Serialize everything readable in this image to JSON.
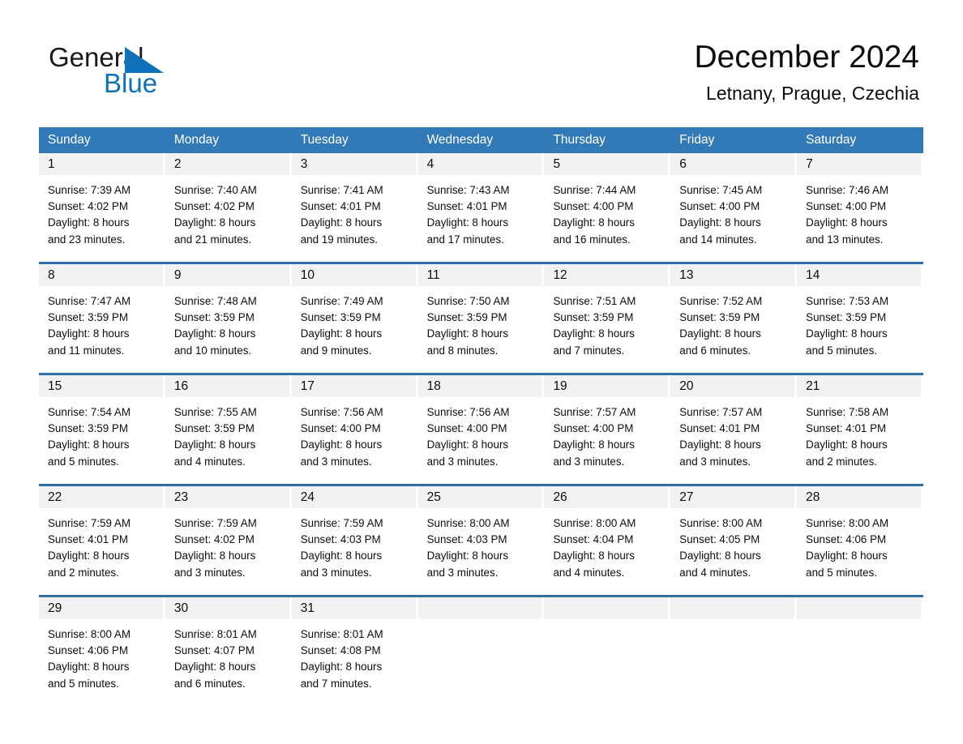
{
  "brand": {
    "name_part1": "General",
    "name_part2": "Blue",
    "triangle_color": "#0f71b9",
    "text_color": "#1a1a1a"
  },
  "header": {
    "title": "December 2024",
    "location": "Letnany, Prague, Czechia"
  },
  "theme": {
    "header_band": "#3279b7",
    "week_divider": "#2f6ea8",
    "day_band": "#f2f2f2",
    "text": "#0d0d0d",
    "page_background": "#ffffff"
  },
  "weekdays": [
    "Sunday",
    "Monday",
    "Tuesday",
    "Wednesday",
    "Thursday",
    "Friday",
    "Saturday"
  ],
  "labels": {
    "sunrise_prefix": "Sunrise:",
    "sunset_prefix": "Sunset:",
    "daylight_prefix": "Daylight:"
  },
  "weeks": [
    [
      {
        "day": "1",
        "sunrise": "Sunrise: 7:39 AM",
        "sunset": "Sunset: 4:02 PM",
        "daylight_line1": "Daylight: 8 hours",
        "daylight_line2": "and 23 minutes."
      },
      {
        "day": "2",
        "sunrise": "Sunrise: 7:40 AM",
        "sunset": "Sunset: 4:02 PM",
        "daylight_line1": "Daylight: 8 hours",
        "daylight_line2": "and 21 minutes."
      },
      {
        "day": "3",
        "sunrise": "Sunrise: 7:41 AM",
        "sunset": "Sunset: 4:01 PM",
        "daylight_line1": "Daylight: 8 hours",
        "daylight_line2": "and 19 minutes."
      },
      {
        "day": "4",
        "sunrise": "Sunrise: 7:43 AM",
        "sunset": "Sunset: 4:01 PM",
        "daylight_line1": "Daylight: 8 hours",
        "daylight_line2": "and 17 minutes."
      },
      {
        "day": "5",
        "sunrise": "Sunrise: 7:44 AM",
        "sunset": "Sunset: 4:00 PM",
        "daylight_line1": "Daylight: 8 hours",
        "daylight_line2": "and 16 minutes."
      },
      {
        "day": "6",
        "sunrise": "Sunrise: 7:45 AM",
        "sunset": "Sunset: 4:00 PM",
        "daylight_line1": "Daylight: 8 hours",
        "daylight_line2": "and 14 minutes."
      },
      {
        "day": "7",
        "sunrise": "Sunrise: 7:46 AM",
        "sunset": "Sunset: 4:00 PM",
        "daylight_line1": "Daylight: 8 hours",
        "daylight_line2": "and 13 minutes."
      }
    ],
    [
      {
        "day": "8",
        "sunrise": "Sunrise: 7:47 AM",
        "sunset": "Sunset: 3:59 PM",
        "daylight_line1": "Daylight: 8 hours",
        "daylight_line2": "and 11 minutes."
      },
      {
        "day": "9",
        "sunrise": "Sunrise: 7:48 AM",
        "sunset": "Sunset: 3:59 PM",
        "daylight_line1": "Daylight: 8 hours",
        "daylight_line2": "and 10 minutes."
      },
      {
        "day": "10",
        "sunrise": "Sunrise: 7:49 AM",
        "sunset": "Sunset: 3:59 PM",
        "daylight_line1": "Daylight: 8 hours",
        "daylight_line2": "and 9 minutes."
      },
      {
        "day": "11",
        "sunrise": "Sunrise: 7:50 AM",
        "sunset": "Sunset: 3:59 PM",
        "daylight_line1": "Daylight: 8 hours",
        "daylight_line2": "and 8 minutes."
      },
      {
        "day": "12",
        "sunrise": "Sunrise: 7:51 AM",
        "sunset": "Sunset: 3:59 PM",
        "daylight_line1": "Daylight: 8 hours",
        "daylight_line2": "and 7 minutes."
      },
      {
        "day": "13",
        "sunrise": "Sunrise: 7:52 AM",
        "sunset": "Sunset: 3:59 PM",
        "daylight_line1": "Daylight: 8 hours",
        "daylight_line2": "and 6 minutes."
      },
      {
        "day": "14",
        "sunrise": "Sunrise: 7:53 AM",
        "sunset": "Sunset: 3:59 PM",
        "daylight_line1": "Daylight: 8 hours",
        "daylight_line2": "and 5 minutes."
      }
    ],
    [
      {
        "day": "15",
        "sunrise": "Sunrise: 7:54 AM",
        "sunset": "Sunset: 3:59 PM",
        "daylight_line1": "Daylight: 8 hours",
        "daylight_line2": "and 5 minutes."
      },
      {
        "day": "16",
        "sunrise": "Sunrise: 7:55 AM",
        "sunset": "Sunset: 3:59 PM",
        "daylight_line1": "Daylight: 8 hours",
        "daylight_line2": "and 4 minutes."
      },
      {
        "day": "17",
        "sunrise": "Sunrise: 7:56 AM",
        "sunset": "Sunset: 4:00 PM",
        "daylight_line1": "Daylight: 8 hours",
        "daylight_line2": "and 3 minutes."
      },
      {
        "day": "18",
        "sunrise": "Sunrise: 7:56 AM",
        "sunset": "Sunset: 4:00 PM",
        "daylight_line1": "Daylight: 8 hours",
        "daylight_line2": "and 3 minutes."
      },
      {
        "day": "19",
        "sunrise": "Sunrise: 7:57 AM",
        "sunset": "Sunset: 4:00 PM",
        "daylight_line1": "Daylight: 8 hours",
        "daylight_line2": "and 3 minutes."
      },
      {
        "day": "20",
        "sunrise": "Sunrise: 7:57 AM",
        "sunset": "Sunset: 4:01 PM",
        "daylight_line1": "Daylight: 8 hours",
        "daylight_line2": "and 3 minutes."
      },
      {
        "day": "21",
        "sunrise": "Sunrise: 7:58 AM",
        "sunset": "Sunset: 4:01 PM",
        "daylight_line1": "Daylight: 8 hours",
        "daylight_line2": "and 2 minutes."
      }
    ],
    [
      {
        "day": "22",
        "sunrise": "Sunrise: 7:59 AM",
        "sunset": "Sunset: 4:01 PM",
        "daylight_line1": "Daylight: 8 hours",
        "daylight_line2": "and 2 minutes."
      },
      {
        "day": "23",
        "sunrise": "Sunrise: 7:59 AM",
        "sunset": "Sunset: 4:02 PM",
        "daylight_line1": "Daylight: 8 hours",
        "daylight_line2": "and 3 minutes."
      },
      {
        "day": "24",
        "sunrise": "Sunrise: 7:59 AM",
        "sunset": "Sunset: 4:03 PM",
        "daylight_line1": "Daylight: 8 hours",
        "daylight_line2": "and 3 minutes."
      },
      {
        "day": "25",
        "sunrise": "Sunrise: 8:00 AM",
        "sunset": "Sunset: 4:03 PM",
        "daylight_line1": "Daylight: 8 hours",
        "daylight_line2": "and 3 minutes."
      },
      {
        "day": "26",
        "sunrise": "Sunrise: 8:00 AM",
        "sunset": "Sunset: 4:04 PM",
        "daylight_line1": "Daylight: 8 hours",
        "daylight_line2": "and 4 minutes."
      },
      {
        "day": "27",
        "sunrise": "Sunrise: 8:00 AM",
        "sunset": "Sunset: 4:05 PM",
        "daylight_line1": "Daylight: 8 hours",
        "daylight_line2": "and 4 minutes."
      },
      {
        "day": "28",
        "sunrise": "Sunrise: 8:00 AM",
        "sunset": "Sunset: 4:06 PM",
        "daylight_line1": "Daylight: 8 hours",
        "daylight_line2": "and 5 minutes."
      }
    ],
    [
      {
        "day": "29",
        "sunrise": "Sunrise: 8:00 AM",
        "sunset": "Sunset: 4:06 PM",
        "daylight_line1": "Daylight: 8 hours",
        "daylight_line2": "and 5 minutes."
      },
      {
        "day": "30",
        "sunrise": "Sunrise: 8:01 AM",
        "sunset": "Sunset: 4:07 PM",
        "daylight_line1": "Daylight: 8 hours",
        "daylight_line2": "and 6 minutes."
      },
      {
        "day": "31",
        "sunrise": "Sunrise: 8:01 AM",
        "sunset": "Sunset: 4:08 PM",
        "daylight_line1": "Daylight: 8 hours",
        "daylight_line2": "and 7 minutes."
      },
      {
        "day": "",
        "sunrise": "",
        "sunset": "",
        "daylight_line1": "",
        "daylight_line2": ""
      },
      {
        "day": "",
        "sunrise": "",
        "sunset": "",
        "daylight_line1": "",
        "daylight_line2": ""
      },
      {
        "day": "",
        "sunrise": "",
        "sunset": "",
        "daylight_line1": "",
        "daylight_line2": ""
      },
      {
        "day": "",
        "sunrise": "",
        "sunset": "",
        "daylight_line1": "",
        "daylight_line2": ""
      }
    ]
  ]
}
